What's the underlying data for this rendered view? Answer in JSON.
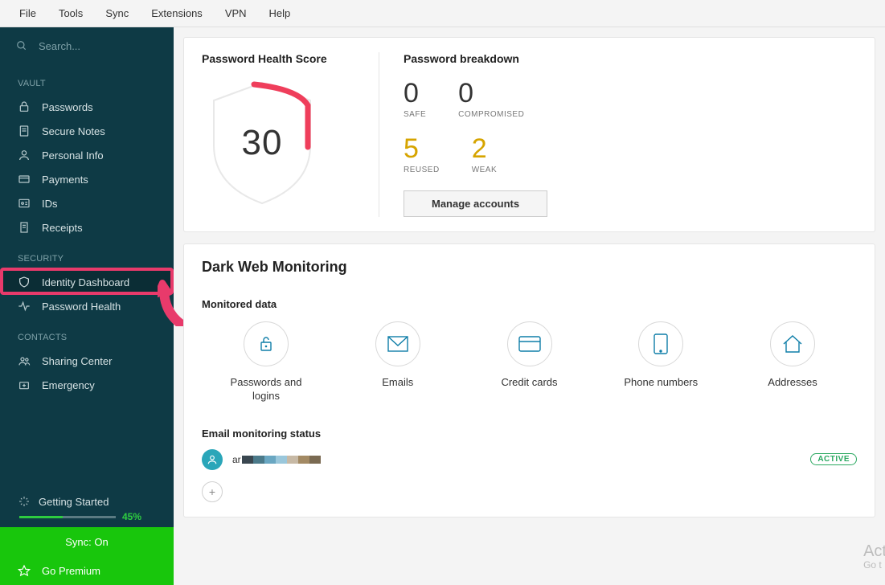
{
  "menu": {
    "items": [
      "File",
      "Tools",
      "Sync",
      "Extensions",
      "VPN",
      "Help"
    ]
  },
  "search": {
    "placeholder": "Search..."
  },
  "sidebar": {
    "sections": {
      "vault": {
        "label": "VAULT",
        "items": [
          "Passwords",
          "Secure Notes",
          "Personal Info",
          "Payments",
          "IDs",
          "Receipts"
        ]
      },
      "security": {
        "label": "SECURITY",
        "items": [
          "Identity Dashboard",
          "Password Health"
        ]
      },
      "contacts": {
        "label": "CONTACTS",
        "items": [
          "Sharing Center",
          "Emergency"
        ]
      }
    },
    "gettingStarted": {
      "label": "Getting Started",
      "percent": "45%",
      "fill": 45
    },
    "sync": {
      "label": "Sync: On"
    },
    "premium": {
      "label": "Go Premium"
    }
  },
  "health": {
    "title": "Password Health Score",
    "score": "30",
    "breakdownTitle": "Password breakdown",
    "safe": {
      "value": "0",
      "label": "SAFE"
    },
    "compromised": {
      "value": "0",
      "label": "COMPROMISED"
    },
    "reused": {
      "value": "5",
      "label": "REUSED"
    },
    "weak": {
      "value": "2",
      "label": "WEAK"
    },
    "manage": "Manage accounts"
  },
  "darkweb": {
    "title": "Dark Web Monitoring",
    "monitoredTitle": "Monitored data",
    "items": [
      "Passwords and logins",
      "Emails",
      "Credit cards",
      "Phone numbers",
      "Addresses"
    ],
    "emsTitle": "Email monitoring status",
    "emailPrefix": "ar",
    "status": "ACTIVE",
    "add": "+"
  },
  "watermark": {
    "l1": "Act",
    "l2": "Go t"
  },
  "colors": {
    "redactBlocks": [
      "#3a4750",
      "#4b7a8a",
      "#6aa7c2",
      "#9ac7db",
      "#c7b9a5",
      "#a38a64",
      "#7a6a52"
    ]
  }
}
